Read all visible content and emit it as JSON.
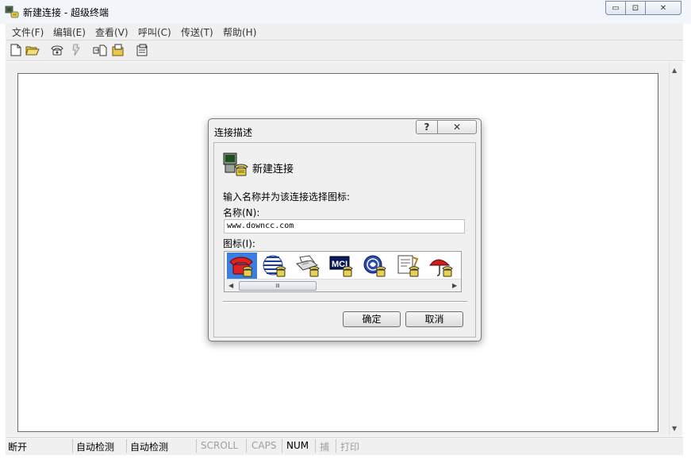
{
  "window": {
    "title": "新建连接 - 超级终端",
    "controls": {
      "minimize": "▭",
      "maximize": "⊡",
      "close": "✕"
    }
  },
  "menu": [
    {
      "label": "文件(F)"
    },
    {
      "label": "编辑(E)"
    },
    {
      "label": "查看(V)"
    },
    {
      "label": "呼叫(C)"
    },
    {
      "label": "传送(T)"
    },
    {
      "label": "帮助(H)"
    }
  ],
  "toolbar_icons": [
    "new-file-icon",
    "open-folder-icon",
    "dial-phone-icon",
    "disconnect-icon",
    "send-file-icon",
    "receive-file-icon",
    "properties-icon"
  ],
  "dialog": {
    "title": "连接描述",
    "help": "?",
    "close": "✕",
    "heading": "新建连接",
    "prompt": "输入名称并为该连接选择图标:",
    "name_label": "名称(N):",
    "name_value": "www.downcc.com",
    "icon_label": "图标(I):",
    "scroll_thumb": "Ⅲ",
    "ok": "确定",
    "cancel": "取消",
    "icons": [
      "red-phone-icon",
      "globe-icon",
      "printer-icon",
      "mci-icon",
      "ge-icon",
      "document-icon",
      "umbrella-icon"
    ],
    "mci_text": "MCI"
  },
  "status": {
    "connection": "断开",
    "detect1": "自动检测",
    "detect2": "自动检测",
    "scroll": "SCROLL",
    "caps": "CAPS",
    "num": "NUM",
    "capture": "捕",
    "print": "打印"
  }
}
